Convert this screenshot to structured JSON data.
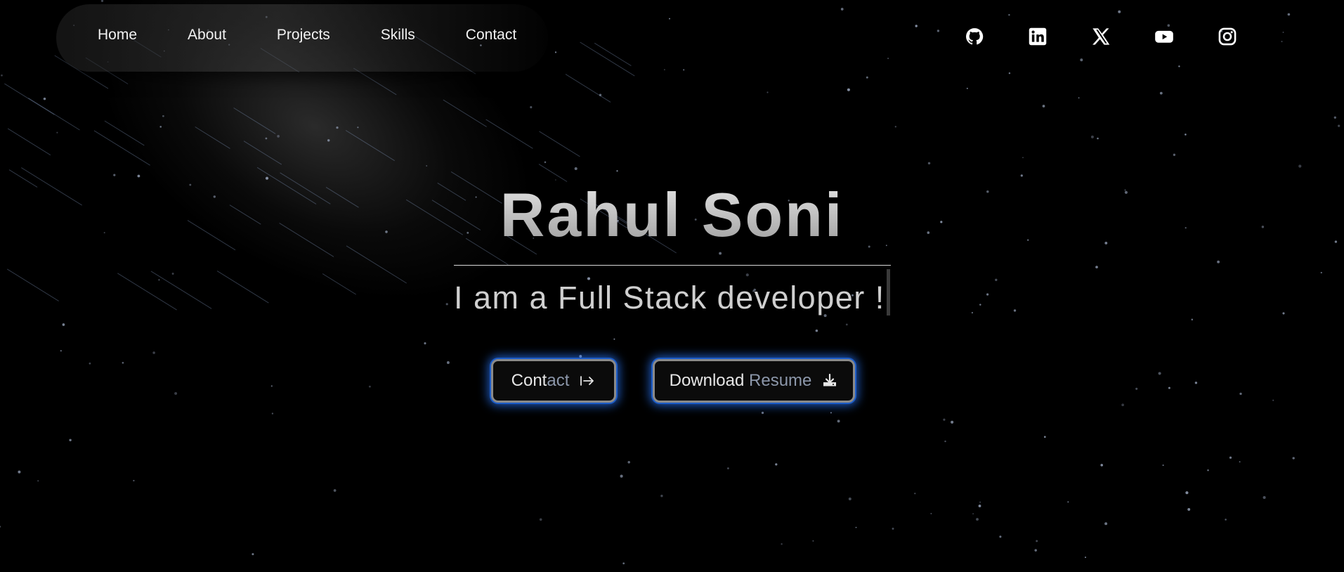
{
  "nav": {
    "links": [
      {
        "label": "Home"
      },
      {
        "label": "About"
      },
      {
        "label": "Projects"
      },
      {
        "label": "Skills"
      },
      {
        "label": "Contact"
      }
    ]
  },
  "socials": [
    {
      "icon": "github-icon"
    },
    {
      "icon": "linkedin-icon"
    },
    {
      "icon": "x-icon"
    },
    {
      "icon": "youtube-icon"
    },
    {
      "icon": "instagram-icon"
    }
  ],
  "hero": {
    "name": "Rahul Soni",
    "tagline": "I am a Full Stack developer !"
  },
  "buttons": {
    "contact": {
      "label_a": "Cont",
      "label_b": "act",
      "icon": "arrow-to-right-icon"
    },
    "resume": {
      "label_a": "Download",
      "label_b": "Resume",
      "icon": "download-icon"
    }
  },
  "colors": {
    "background": "#000000",
    "button_glow": "#2878ff",
    "text": "#f2f2f2"
  }
}
